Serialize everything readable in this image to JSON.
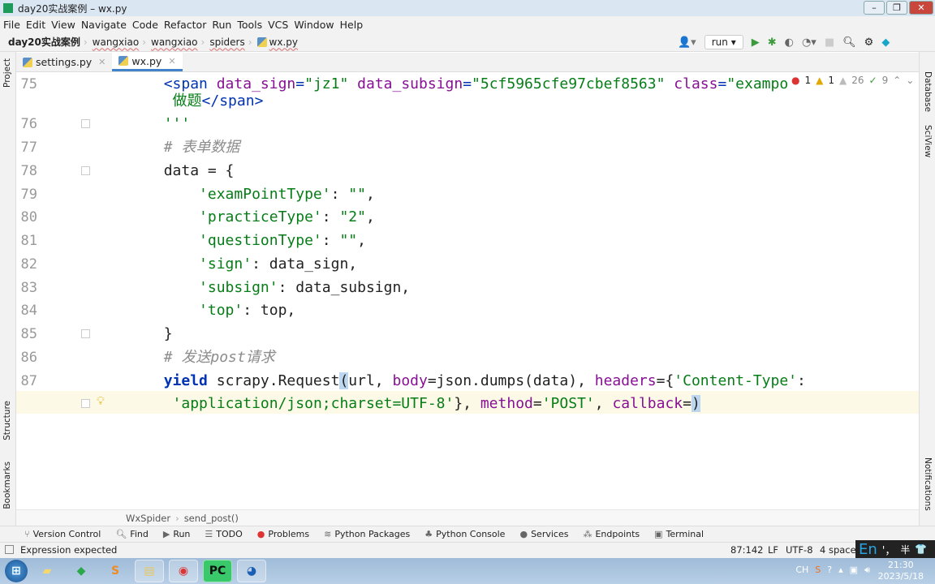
{
  "window": {
    "title": "day20实战案例 – wx.py"
  },
  "menu": [
    "File",
    "Edit",
    "View",
    "Navigate",
    "Code",
    "Refactor",
    "Run",
    "Tools",
    "VCS",
    "Window",
    "Help"
  ],
  "breadcrumb": [
    "day20实战案例",
    "wangxiao",
    "wangxiao",
    "spiders",
    "wx.py"
  ],
  "toolbar": {
    "run_config": "run"
  },
  "tabs": [
    {
      "label": "settings.py",
      "active": false
    },
    {
      "label": "wx.py",
      "active": true
    }
  ],
  "left_stripe": [
    "Project",
    "Structure",
    "Bookmarks"
  ],
  "right_stripe": [
    "Database",
    "SciView",
    "Notifications"
  ],
  "inspections": {
    "errors": "1",
    "warnings": "1",
    "weak_warnings": "26",
    "typos": "9"
  },
  "code_lines": [
    {
      "num": "75",
      "fold": false,
      "tokens": [
        [
          "tag",
          "        <span "
        ],
        [
          "param",
          "data_sign"
        ],
        [
          "tag",
          "="
        ],
        [
          "str",
          "\"jz1\""
        ],
        [
          "tag",
          " "
        ],
        [
          "param",
          "data_subsign"
        ],
        [
          "tag",
          "="
        ],
        [
          "str",
          "\"5cf5965cfe97cbef8563\""
        ],
        [
          "tag",
          " "
        ],
        [
          "param",
          "class"
        ],
        [
          "tag",
          "="
        ],
        [
          "str",
          "\"exampo"
        ]
      ]
    },
    {
      "num": "",
      "fold": false,
      "tokens": [
        [
          "str",
          "         做题"
        ],
        [
          "tag",
          "</span>"
        ]
      ]
    },
    {
      "num": "76",
      "fold": true,
      "tokens": [
        [
          "str",
          "        '''"
        ]
      ]
    },
    {
      "num": "77",
      "fold": false,
      "tokens": [
        [
          "cm",
          "        # 表单数据"
        ]
      ]
    },
    {
      "num": "78",
      "fold": true,
      "tokens": [
        [
          "",
          "        data = {"
        ]
      ]
    },
    {
      "num": "79",
      "fold": false,
      "tokens": [
        [
          "",
          "            "
        ],
        [
          "str",
          "'examPointType'"
        ],
        [
          "",
          ": "
        ],
        [
          "str",
          "\"\""
        ],
        [
          "",
          ","
        ]
      ]
    },
    {
      "num": "80",
      "fold": false,
      "tokens": [
        [
          "",
          "            "
        ],
        [
          "str",
          "'practiceType'"
        ],
        [
          "",
          ": "
        ],
        [
          "str",
          "\"2\""
        ],
        [
          "",
          ","
        ]
      ]
    },
    {
      "num": "81",
      "fold": false,
      "tokens": [
        [
          "",
          "            "
        ],
        [
          "str",
          "'questionType'"
        ],
        [
          "",
          ": "
        ],
        [
          "str",
          "\"\""
        ],
        [
          "",
          ","
        ]
      ]
    },
    {
      "num": "82",
      "fold": false,
      "tokens": [
        [
          "",
          "            "
        ],
        [
          "str",
          "'sign'"
        ],
        [
          "",
          ": data_sign,"
        ]
      ]
    },
    {
      "num": "83",
      "fold": false,
      "tokens": [
        [
          "",
          "            "
        ],
        [
          "str",
          "'subsign'"
        ],
        [
          "",
          ": data_subsign,"
        ]
      ]
    },
    {
      "num": "84",
      "fold": false,
      "tokens": [
        [
          "",
          "            "
        ],
        [
          "str",
          "'top'"
        ],
        [
          "",
          ": top,"
        ]
      ]
    },
    {
      "num": "85",
      "fold": true,
      "tokens": [
        [
          "",
          "        }"
        ]
      ]
    },
    {
      "num": "86",
      "fold": false,
      "tokens": [
        [
          "cm",
          "        # 发送post请求"
        ]
      ]
    },
    {
      "num": "87",
      "fold": false,
      "tokens": [
        [
          "",
          "        "
        ],
        [
          "kw",
          "yield"
        ],
        [
          "",
          " scrapy.Request"
        ],
        [
          "brace",
          "("
        ],
        [
          "",
          "url, "
        ],
        [
          "param",
          "body"
        ],
        [
          "",
          "=json.dumps(data), "
        ],
        [
          "param",
          "headers"
        ],
        [
          "",
          "={"
        ],
        [
          "str",
          "'Content-Type'"
        ],
        [
          "",
          ":"
        ]
      ]
    },
    {
      "num": "",
      "fold": true,
      "current": true,
      "tokens": [
        [
          "",
          "         "
        ],
        [
          "str",
          "'application/json;charset=UTF-8'"
        ],
        [
          "",
          "}, "
        ],
        [
          "param",
          "method"
        ],
        [
          "",
          "="
        ],
        [
          "str",
          "'POST'"
        ],
        [
          "",
          ", "
        ],
        [
          "param",
          "callback"
        ],
        [
          "",
          "="
        ],
        [
          "brace",
          ")"
        ]
      ]
    }
  ],
  "editor_breadcrumb": [
    "WxSpider",
    "send_post()"
  ],
  "tool_windows": [
    "Version Control",
    "Find",
    "Run",
    "TODO",
    "Problems",
    "Python Packages",
    "Python Console",
    "Services",
    "Endpoints",
    "Terminal"
  ],
  "status": {
    "message": "Expression expected",
    "position": "87:142",
    "line_sep": "LF",
    "encoding": "UTF-8",
    "indent": "4 spaces"
  },
  "ime": {
    "lang": "En",
    "mode": "半"
  },
  "taskbar": {
    "time": "21:30",
    "date": "2023/5/18",
    "tray_lang": "CH"
  },
  "colors": {
    "keyword": "#0033b3",
    "string": "#067d17",
    "comment": "#8c8c8c",
    "param": "#871094",
    "accent": "#4083c9",
    "current_line": "#fcfae6"
  }
}
